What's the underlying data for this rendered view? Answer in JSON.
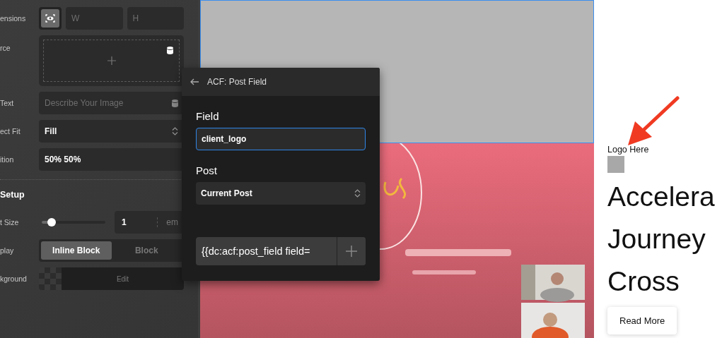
{
  "sidebar": {
    "dimensions": {
      "label": "ensions",
      "fit_toggle_on": true,
      "width_placeholder": "W",
      "height_placeholder": "H"
    },
    "source": {
      "label": "rce"
    },
    "alt_text": {
      "label": "Text",
      "placeholder": "Describe Your Image"
    },
    "object_fit": {
      "label": "ect Fit",
      "value": "Fill"
    },
    "position": {
      "label": "ition",
      "value": "50% 50%"
    },
    "section_title": "Setup",
    "font_size": {
      "label": "t Size",
      "value": "1",
      "unit": "em",
      "level": 0.15
    },
    "display": {
      "label": "play",
      "options": [
        {
          "label": "Inline Block",
          "selected": true
        },
        {
          "label": "Block",
          "selected": false
        }
      ]
    },
    "background": {
      "label": "kground",
      "button": "Edit"
    }
  },
  "popup": {
    "title": "ACF: Post Field",
    "field_label": "Field",
    "field_value": "client_logo",
    "post_label": "Post",
    "post_value": "Current Post",
    "tag_value": "{{dc:acf:post_field field="
  },
  "page": {
    "logo_label": "Logo Here",
    "heading": "Accelera\nJourney\nCross",
    "button": "Read More"
  }
}
